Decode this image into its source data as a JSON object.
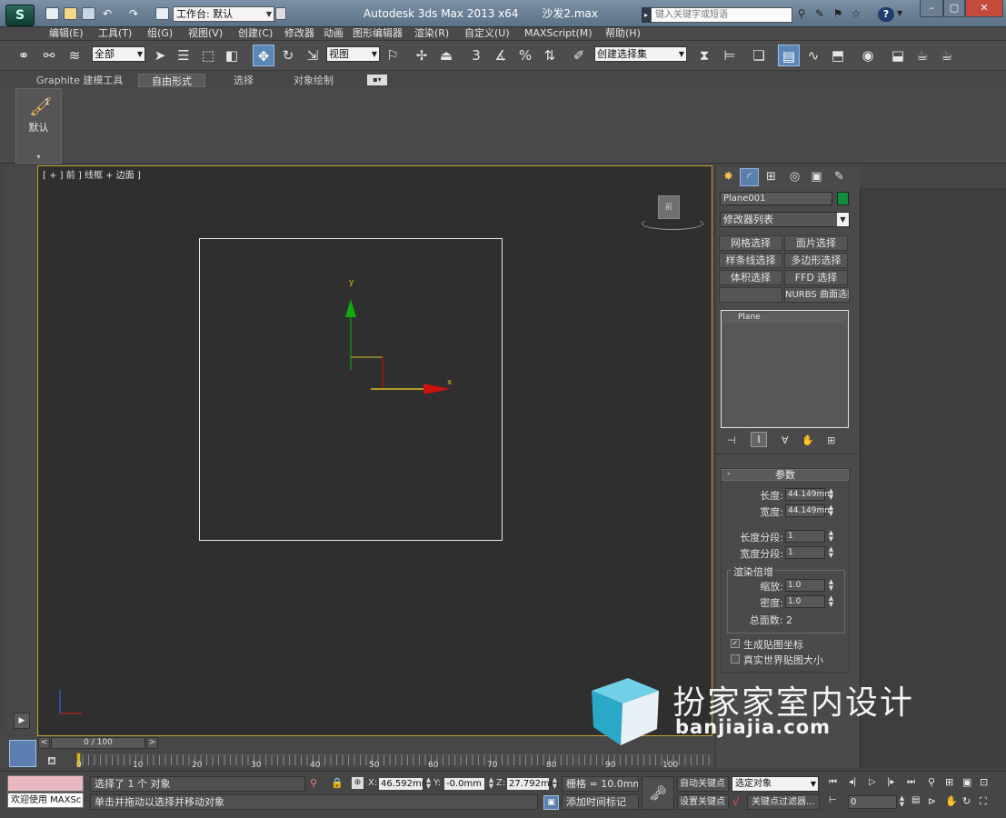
{
  "titlebar": {
    "app_icon": "3ds-max-logo",
    "workspace_label": "工作台: 默认",
    "app_title": "Autodesk 3ds Max  2013 x64",
    "file_name": "沙发2.max",
    "search_placeholder": "键入关键字或短语",
    "help_label": "?"
  },
  "menu": {
    "items": [
      "编辑(E)",
      "工具(T)",
      "组(G)",
      "视图(V)",
      "创建(C)",
      "修改器",
      "动画",
      "图形编辑器",
      "渲染(R)",
      "自定义(U)",
      "MAXScript(M)",
      "帮助(H)"
    ]
  },
  "toolbar": {
    "filter_value": "全部",
    "ref_coord_value": "视图",
    "named_selection_value": "创建选择集",
    "snap_label": "3",
    "angle_snap_label": "%"
  },
  "ribbon": {
    "tabs": [
      "Graphite 建模工具",
      "自由形式",
      "选择",
      "对象绘制"
    ],
    "active_tab": "自由形式",
    "default_button_label": "默认",
    "default_button_badge": "1"
  },
  "viewport": {
    "label": "[ + ] 前 ] 线框 + 边面 ]",
    "gizmo_y": "y",
    "gizmo_x": "x",
    "axis_colors": {
      "x": "#cc1111",
      "y": "#11aa11"
    }
  },
  "cmdpanel": {
    "object_name": "Plane001",
    "object_color": "#0f8f3a",
    "modifier_list": "修改器列表",
    "buttons": [
      "网格选择",
      "面片选择",
      "样条线选择",
      "多边形选择",
      "体积选择",
      "FFD 选择",
      "",
      "NURBS 曲面选择"
    ],
    "stack_item": "Plane",
    "rollout_title": "参数",
    "length_label": "长度:",
    "length_value": "44.149mm",
    "width_label": "宽度:",
    "width_value": "44.149mm",
    "length_segs_label": "长度分段:",
    "length_segs_value": "1",
    "width_segs_label": "宽度分段:",
    "width_segs_value": "1",
    "render_group": "渲染倍增",
    "scale_label": "缩放:",
    "scale_value": "1.0",
    "density_label": "密度:",
    "density_value": "1.0",
    "total_faces": "总面数: 2",
    "gen_map_coords": "生成贴图坐标",
    "gen_map_checked": true,
    "real_world_map": "真实世界贴图大小",
    "real_world_checked": false
  },
  "timeline": {
    "frame_display": "0 / 100",
    "ticks": [
      "0",
      "10",
      "20",
      "30",
      "40",
      "50",
      "60",
      "70",
      "80",
      "90",
      "100"
    ]
  },
  "status": {
    "welcome": "欢迎使用 MAXSc",
    "selected": "选择了 1 个 对象",
    "prompt": "单击并拖动以选择并移动对象",
    "x_label": "X:",
    "x_value": "46.592mm",
    "y_label": "Y:",
    "y_value": "-0.0mm",
    "z_label": "Z:",
    "z_value": "27.792mm",
    "grid": "栅格 = 10.0mm",
    "auto_key": "自动关键点",
    "set_key": "设置关键点",
    "selected_obj": "选定对象",
    "key_filters": "关键点过滤器...",
    "add_time_tag": "添加时间标记",
    "frame_value": "0"
  },
  "watermark": {
    "cn": "扮家家室内设计",
    "en": "banjiajia.com"
  }
}
